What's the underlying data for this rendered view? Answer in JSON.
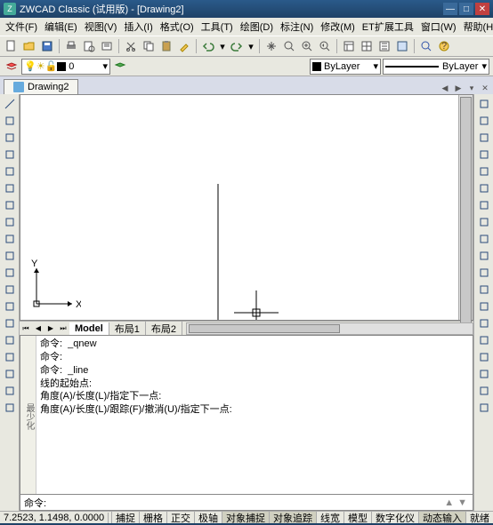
{
  "title": "ZWCAD Classic (试用版) - [Drawing2]",
  "menus": [
    "文件(F)",
    "编辑(E)",
    "视图(V)",
    "插入(I)",
    "格式(O)",
    "工具(T)",
    "绘图(D)",
    "标注(N)",
    "修改(M)",
    "ET扩展工具",
    "窗口(W)",
    "帮助(H)"
  ],
  "layer": {
    "name": "0",
    "bylayer": "ByLayer",
    "linetype": "ByLayer"
  },
  "doc_tab": "Drawing2",
  "model_tabs": {
    "active": "Model",
    "tabs": [
      "Model",
      "布局1",
      "布局2"
    ]
  },
  "cmd_lines": [
    "命令:  _qnew",
    "命令:",
    "命令:  _line",
    "线的起始点:",
    "角度(A)/长度(L)/指定下一点:",
    "角度(A)/长度(L)/跟踪(F)/撤消(U)/指定下一点:"
  ],
  "cmd_prompt": "命令:",
  "cmd_side": "最少化",
  "coords": "7.2523, 1.1498, 0.0000",
  "status_btns": [
    "捕捉",
    "栅格",
    "正交",
    "极轴",
    "对象捕捉",
    "对象追踪",
    "线宽",
    "模型",
    "数字化仪",
    "动态输入",
    "就绪"
  ],
  "status_active": [
    "对象捕捉",
    "对象追踪",
    "动态输入"
  ],
  "ucs": {
    "x": "X",
    "y": "Y"
  },
  "icons": {
    "left": [
      "line",
      "construction-line",
      "polyline",
      "polygon",
      "rectangle",
      "arc",
      "circle",
      "revision-cloud",
      "spline",
      "ellipse",
      "ellipse-arc",
      "insert-block",
      "make-block",
      "point",
      "hatch",
      "gradient",
      "region",
      "table",
      "multiline-text"
    ],
    "right": [
      "distance",
      "area",
      "region-mass",
      "list",
      "id-point",
      "dim-linear",
      "dim-aligned",
      "dim-arc",
      "dim-ordinate",
      "dim-radius",
      "dim-diameter",
      "dim-angular",
      "quick-dim",
      "dim-baseline",
      "dim-continue",
      "leader",
      "tolerance",
      "center-mark",
      "dim-edit"
    ]
  }
}
